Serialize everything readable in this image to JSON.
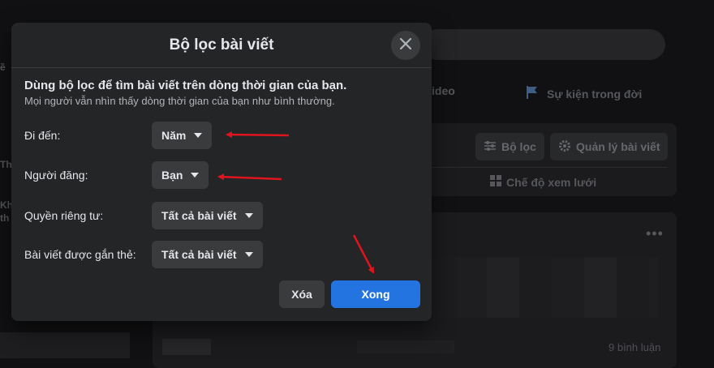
{
  "background": {
    "tab_video_fragment": "ideo",
    "tab_life_events": "Sự kiện trong đời",
    "filter_button": "Bộ lọc",
    "manage_posts_button": "Quản lý bài viết",
    "grid_view": "Chế độ xem lưới",
    "comments_count": "9 bình luận",
    "left_fragments": [
      "ề",
      "Th",
      "Kh",
      "th"
    ]
  },
  "modal": {
    "title": "Bộ lọc bài viết",
    "intro_title": "Dùng bộ lọc để tìm bài viết trên dòng thời gian của bạn.",
    "intro_subtitle": "Mọi người vẫn nhìn thấy dòng thời gian của bạn như bình thường.",
    "filters": [
      {
        "label": "Đi đến:",
        "value": "Năm"
      },
      {
        "label": "Người đăng:",
        "value": "Bạn"
      },
      {
        "label": "Quyền riêng tư:",
        "value": "Tất cả bài viết"
      },
      {
        "label": "Bài viết được gắn thẻ:",
        "value": "Tất cả bài viết"
      }
    ],
    "clear_button": "Xóa",
    "done_button": "Xong"
  },
  "colors": {
    "accent": "#2374e1",
    "annotation_arrow": "#e0141e"
  },
  "icons": [
    "close-icon",
    "caret-down-icon",
    "flag-icon",
    "filter-sliders-icon",
    "gear-icon",
    "grid-icon",
    "more-dots-icon"
  ]
}
